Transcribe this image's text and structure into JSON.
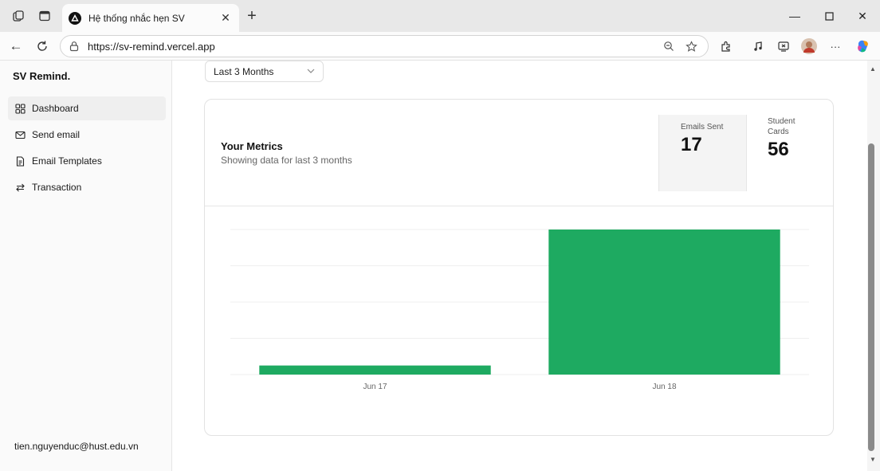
{
  "browser": {
    "tab_title": "Hệ thống nhắc hẹn SV",
    "url": "https://sv-remind.vercel.app"
  },
  "sidebar": {
    "brand": "SV Remind.",
    "items": [
      {
        "label": "Dashboard",
        "icon": "dashboard-icon",
        "active": true
      },
      {
        "label": "Send email",
        "icon": "mail-icon",
        "active": false
      },
      {
        "label": "Email Templates",
        "icon": "document-icon",
        "active": false
      },
      {
        "label": "Transaction",
        "icon": "arrows-swap-icon",
        "active": false
      }
    ],
    "user_email": "tien.nguyenduc@hust.edu.vn"
  },
  "main": {
    "range_select": {
      "value": "Last 3 Months"
    },
    "card": {
      "title": "Your Metrics",
      "subtitle": "Showing data for last 3 months",
      "metrics": [
        {
          "label": "Emails Sent",
          "value": "17",
          "selected": true
        },
        {
          "label": "Student Cards",
          "value": "56",
          "selected": false
        }
      ]
    }
  },
  "chart_data": {
    "type": "bar",
    "categories": [
      "Jun 17",
      "Jun 18"
    ],
    "series": [
      {
        "values": [
          2.5,
          40
        ]
      }
    ],
    "ylim": [
      0,
      40
    ],
    "grid": true,
    "bar_color": "#1eaa61"
  },
  "colors": {
    "accent": "#1eaa61"
  }
}
